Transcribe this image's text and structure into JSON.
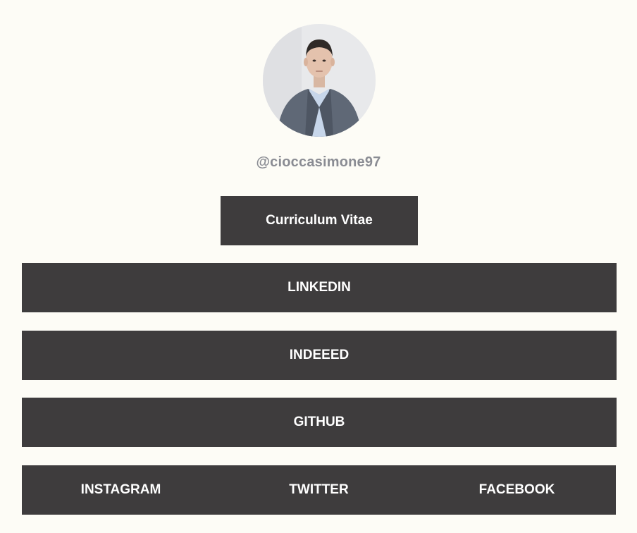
{
  "profile": {
    "handle": "@cioccasimone97",
    "avatar_icon": "profile-photo"
  },
  "buttons": {
    "cv": "Curriculum Vitae",
    "linkedin": "LINKEDIN",
    "indeed": "INDEEED",
    "github": "GITHUB"
  },
  "social": {
    "instagram": "INSTAGRAM",
    "twitter": "TWITTER",
    "facebook": "FACEBOOK"
  },
  "colors": {
    "background": "#fdfcf6",
    "button": "#3e3c3d",
    "button_text": "#ffffff",
    "handle_text": "#8a8c93"
  }
}
